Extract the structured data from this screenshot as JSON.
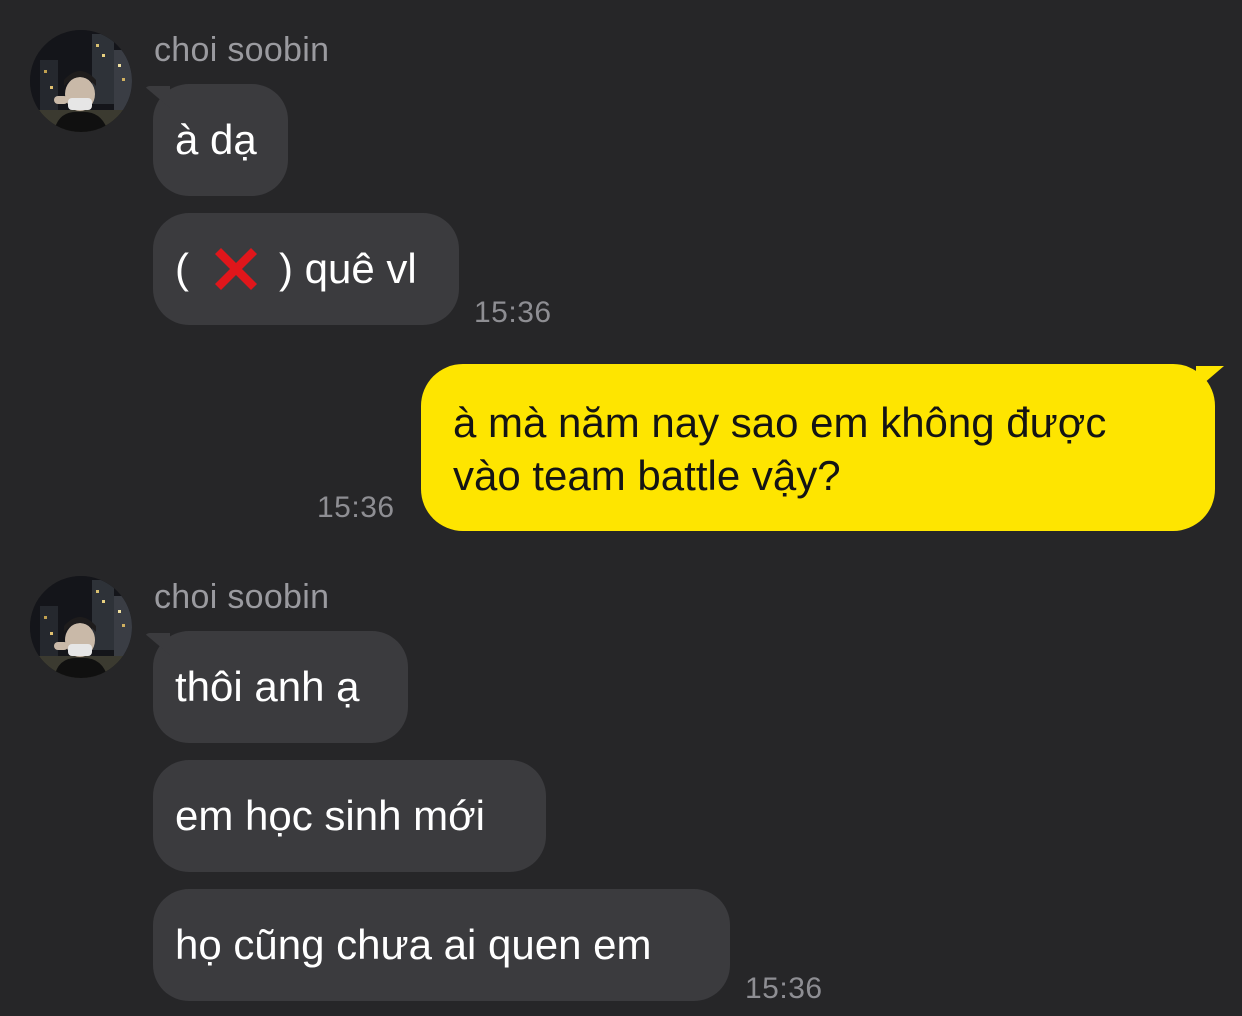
{
  "thread": {
    "group1": {
      "sender": "choi soobin",
      "messages": [
        "à dạ",
        "(",
        ") quê vl"
      ],
      "time": "15:36"
    },
    "outgoing": {
      "line1": "à mà năm nay sao em không được",
      "line2": "vào team battle vậy?",
      "time": "15:36"
    },
    "group2": {
      "sender": "choi soobin",
      "messages": [
        "thôi anh ạ",
        "em học sinh mới",
        "họ cũng chưa ai quen em"
      ],
      "time": "15:36"
    }
  },
  "colors": {
    "background": "#262628",
    "incoming_bubble": "#3b3b3e",
    "outgoing_bubble": "#fee500",
    "timestamp": "#8e8e93",
    "sender_name": "#9a9a9f",
    "cross_emoji": "#e0161b"
  },
  "icons": {
    "avatar": "profile-photo",
    "emoji": "cross-mark-icon"
  }
}
